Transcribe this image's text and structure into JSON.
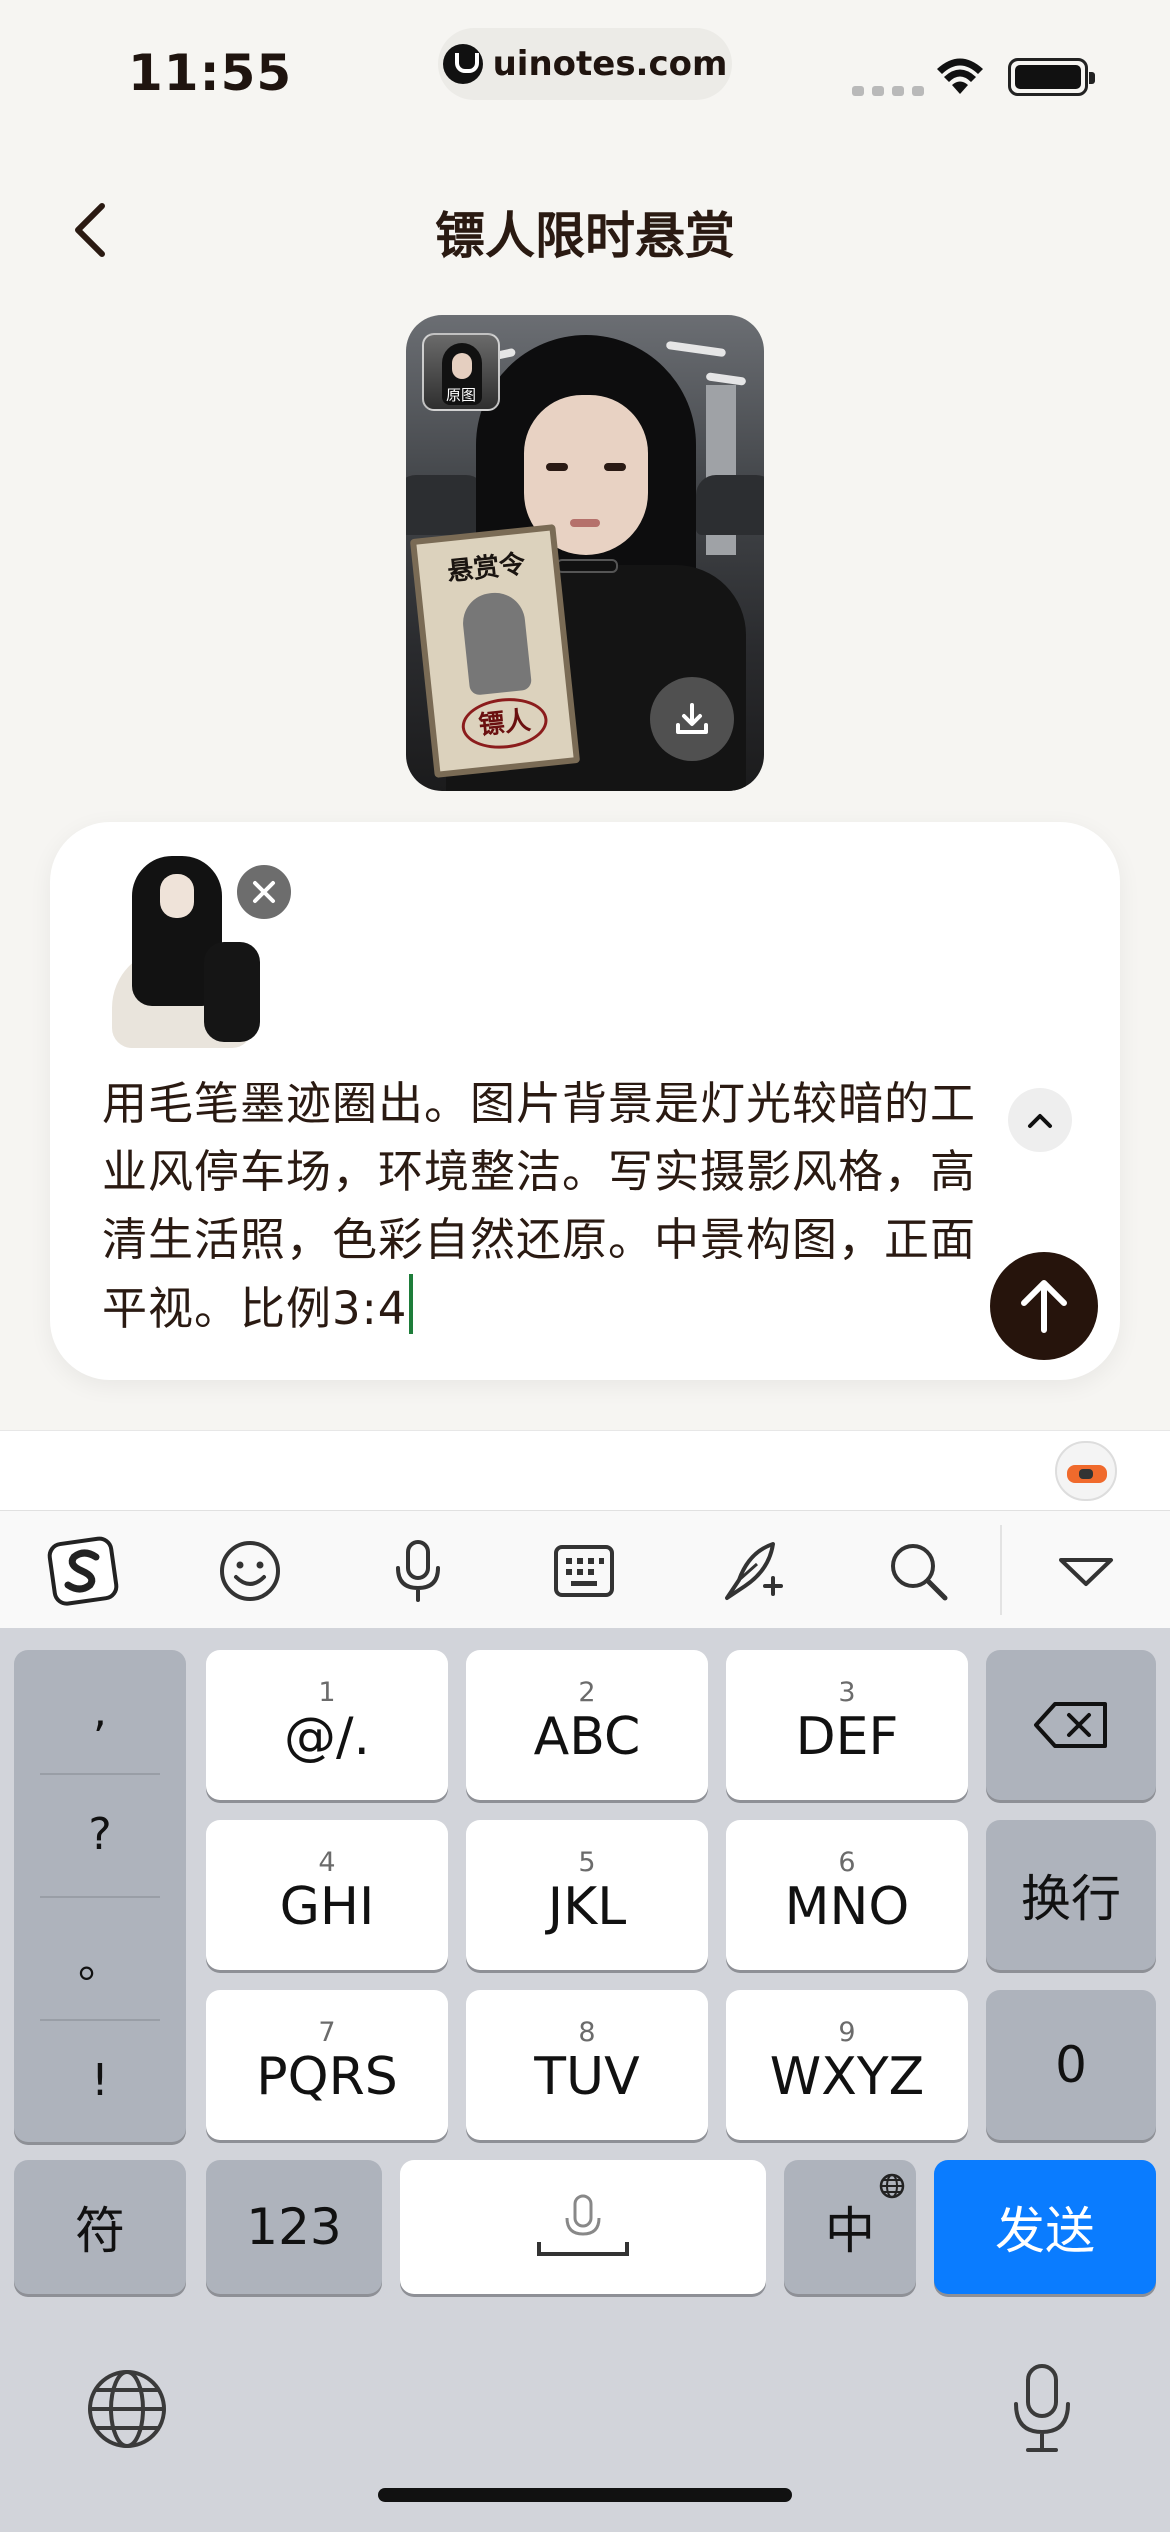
{
  "status_bar": {
    "time": "11:55",
    "url": "uinotes.com"
  },
  "nav": {
    "title": "镖人限时悬赏"
  },
  "hero_image": {
    "thumb_label": "原图",
    "card_title": "悬赏令",
    "card_seal": "镖人"
  },
  "compose": {
    "prompt_text": "用毛笔墨迹圈出。图片背景是灯光较暗的工业风停车场，环境整洁。写实摄影风格，高清生活照，色彩自然还原。中景构图，正面平视。比例3:4"
  },
  "ime_toolbar": {
    "icons": [
      "sogou-logo-icon",
      "emoji-icon",
      "microphone-icon",
      "keyboard-icon",
      "handwriting-icon",
      "search-icon",
      "collapse-keyboard-icon"
    ]
  },
  "keyboard": {
    "punctuation": [
      ",",
      "?",
      "。",
      "!"
    ],
    "keys": [
      {
        "num": "1",
        "letters": "@/."
      },
      {
        "num": "2",
        "letters": "ABC"
      },
      {
        "num": "3",
        "letters": "DEF"
      },
      {
        "num": "4",
        "letters": "GHI"
      },
      {
        "num": "5",
        "letters": "JKL"
      },
      {
        "num": "6",
        "letters": "MNO"
      },
      {
        "num": "7",
        "letters": "PQRS"
      },
      {
        "num": "8",
        "letters": "TUV"
      },
      {
        "num": "9",
        "letters": "WXYZ"
      }
    ],
    "newline": "换行",
    "zero": "0",
    "symbols": "符",
    "numbers": "123",
    "lang": "中",
    "send": "发送"
  },
  "colors": {
    "send_key": "#0a7cff",
    "send_button": "#26140c",
    "background": "#f6f5f2"
  }
}
